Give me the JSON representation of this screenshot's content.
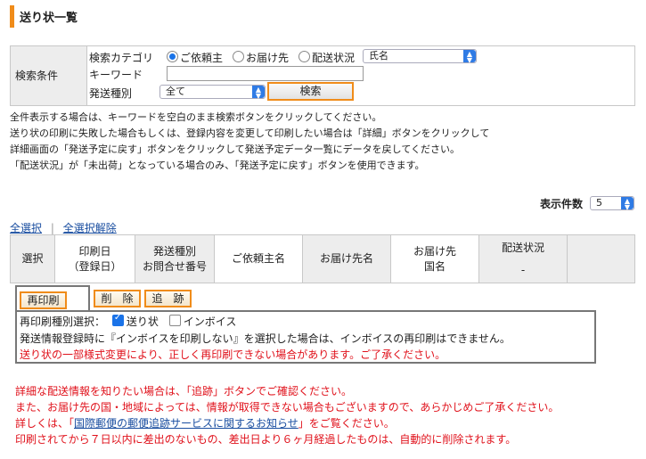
{
  "page": {
    "title": "送り状一覧"
  },
  "search": {
    "label": "検索条件",
    "category_label": "検索カテゴリ",
    "category_options": [
      "ご依頼主",
      "お届け先",
      "配送状況"
    ],
    "category_selected": "ご依頼主",
    "field_select_value": "氏名",
    "keyword_label": "キーワード",
    "keyword_value": "",
    "type_label": "発送種別",
    "type_select_value": "全て",
    "search_button": "検索"
  },
  "info_lines": [
    "全件表示する場合は、キーワードを空白のまま検索ボタンをクリックしてください。",
    "送り状の印刷に失敗した場合もしくは、登録内容を変更して印刷したい場合は「詳細」ボタンをクリックして",
    "詳細画面の「発送予定に戻す」ボタンをクリックして発送予定データ一覧にデータを戻してください。",
    "「配送状況」が「未出荷」となっている場合のみ、「発送予定に戻す」ボタンを使用できます。"
  ],
  "display_count": {
    "label": "表示件数",
    "value": "5"
  },
  "selection": {
    "select_all": "全選択",
    "separator": "|",
    "deselect_all": "全選択解除"
  },
  "table": {
    "headers": {
      "select": "選択",
      "print_date_1": "印刷日",
      "print_date_2": "（登録日）",
      "shipping_type_1": "発送種別",
      "shipping_type_2": "お問合せ番号",
      "requester": "ご依頼主名",
      "recipient": "お届け先名",
      "country_1": "お届け先",
      "country_2": "国名",
      "status": "配送状況",
      "status_sub": "-"
    }
  },
  "actions": {
    "reprint": "再印刷",
    "delete": "削　除",
    "track": "追　跡"
  },
  "reprint": {
    "type_label": "再印刷種別選択：",
    "opt_label": "送り状",
    "opt_label_checked": true,
    "opt_invoice": "インボイス",
    "opt_invoice_checked": false,
    "note": "発送情報登録時に『インボイスを印刷しない』を選択した場合は、インボイスの再印刷はできません。",
    "warning": "送り状の一部様式変更により、正しく再印刷できない場合があります。ご了承ください。"
  },
  "notices": {
    "line1": "詳細な配送情報を知りたい場合は、「追跡」ボタンでご確認ください。",
    "line2": "また、お届け先の国・地域によっては、情報が取得できない場合もございますので、あらかじめご了承ください。",
    "line3_prefix": "詳しくは、「",
    "line3_link": "国際郵便の郵便追跡サービスに関するお知らせ",
    "line3_suffix": "」をご覧ください。",
    "line4": "印刷されてから７日以内に差出のないもの、差出日より６ヶ月経過したものは、自動的に削除されます。"
  },
  "colors": {
    "accent": "#f08c1a",
    "warning": "#e0111b",
    "link": "#1a4ea0",
    "header_bg": "#ededed"
  }
}
